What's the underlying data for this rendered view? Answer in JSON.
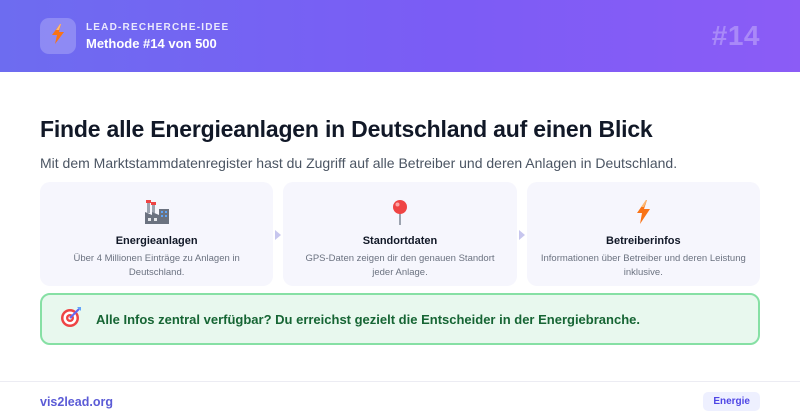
{
  "header": {
    "eyebrow": "LEAD-RECHERCHE-IDEE",
    "method": "Methode #14 von 500",
    "number": "#14",
    "icon": "lightning-icon"
  },
  "main": {
    "title": "Finde alle Energieanlagen in Deutschland auf einen Blick",
    "subtitle": "Mit dem Marktstammdatenregister hast du Zugriff auf alle Betreiber und deren Anlagen in Deutschland."
  },
  "cards": [
    {
      "icon": "factory-icon",
      "title": "Energieanlagen",
      "desc": "Über 4 Millionen Einträge zu Anlagen in Deutschland."
    },
    {
      "icon": "pin-icon",
      "title": "Standortdaten",
      "desc": "GPS-Daten zeigen dir den genauen Standort jeder Anlage."
    },
    {
      "icon": "lightning-icon",
      "title": "Betreiberinfos",
      "desc": "Informationen über Betreiber und deren Leistung inklusive."
    }
  ],
  "callout": {
    "icon": "target-icon",
    "text": "Alle Infos zentral verfügbar? Du erreichst gezielt die Entscheider in der Energiebranche."
  },
  "footer": {
    "link": "vis2lead.org",
    "badge": "Energie"
  },
  "colors": {
    "header_gradient_start": "#6d6cf0",
    "header_gradient_end": "#8b5cf6",
    "callout_bg": "#e8f8ee",
    "callout_border": "#86e0a4",
    "callout_text": "#166534",
    "brand_link": "#5b5bd6"
  }
}
